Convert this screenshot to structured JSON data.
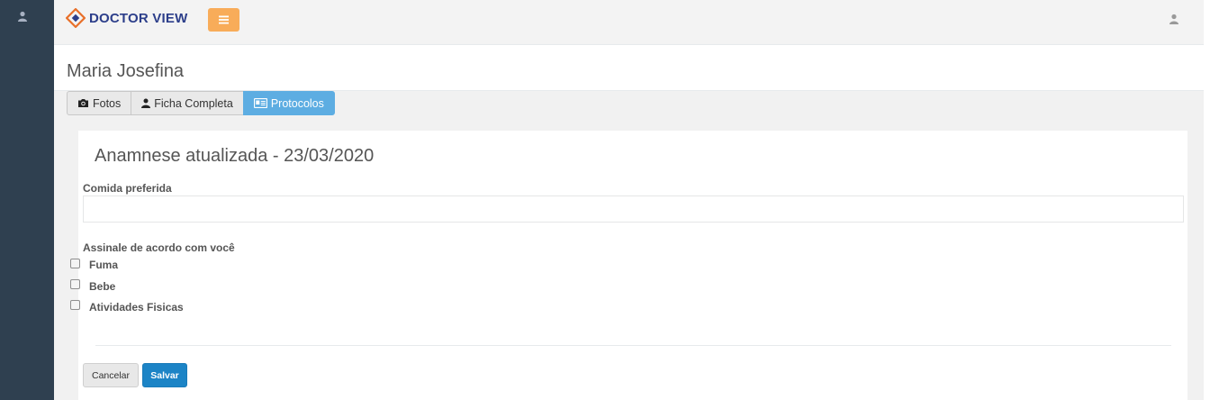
{
  "brand": {
    "name": "DOCTOR VIEW"
  },
  "header": {
    "title": "Maria Josefina"
  },
  "tabs": [
    {
      "label": "Fotos",
      "icon": "camera-icon"
    },
    {
      "label": "Ficha Completa",
      "icon": "user-icon"
    },
    {
      "label": "Protocolos",
      "icon": "id-card-icon"
    }
  ],
  "form": {
    "title": "Anamnese atualizada - 23/03/2020",
    "field_label": "Comida preferida",
    "field_value": "",
    "checkbox_group_label": "Assinale de acordo com você",
    "checkboxes": [
      {
        "label": "Fuma",
        "checked": false
      },
      {
        "label": "Bebe",
        "checked": false
      },
      {
        "label": "Atividades Fisicas",
        "checked": false
      }
    ],
    "cancel_label": "Cancelar",
    "save_label": "Salvar"
  },
  "colors": {
    "sidebar": "#2f4050",
    "menu_button": "#f8ac59",
    "active_tab": "#5dade2",
    "primary_button": "#1c84c6",
    "brand_text": "#2c3e8a"
  }
}
